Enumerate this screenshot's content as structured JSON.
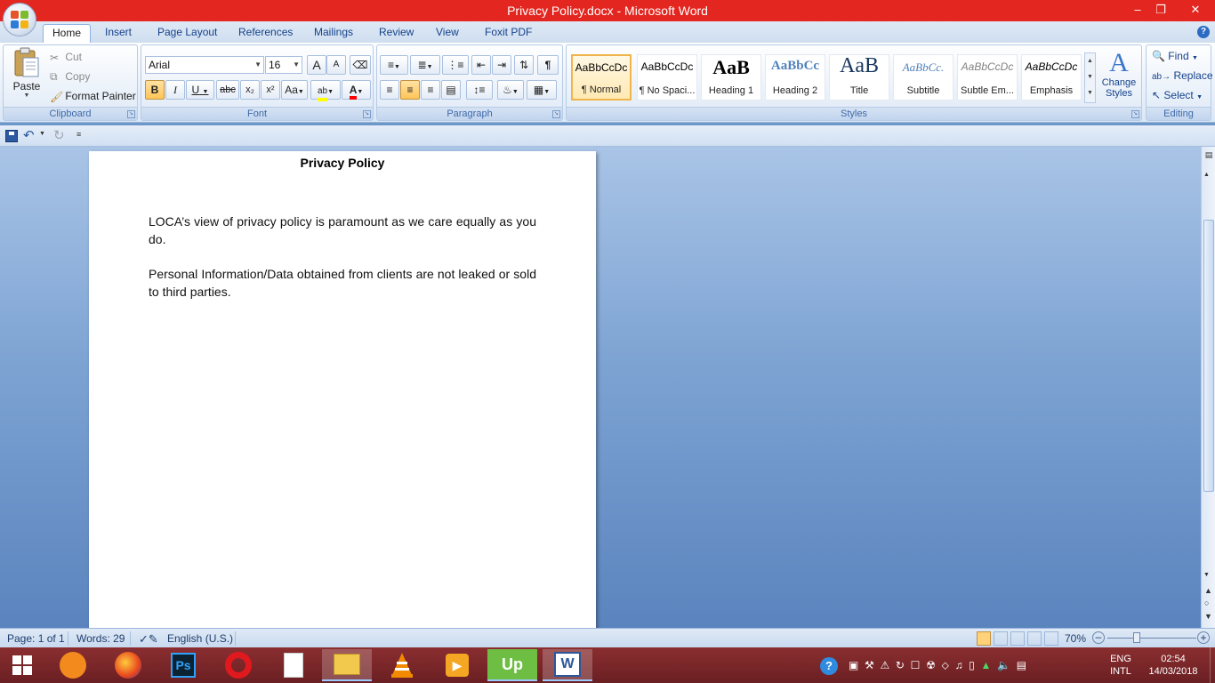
{
  "window": {
    "title": "Privacy Policy.docx - Microsoft Word"
  },
  "tabs": [
    "Home",
    "Insert",
    "Page Layout",
    "References",
    "Mailings",
    "Review",
    "View",
    "Foxit PDF"
  ],
  "clipboard": {
    "paste": "Paste",
    "cut": "Cut",
    "copy": "Copy",
    "format_painter": "Format Painter",
    "label": "Clipboard"
  },
  "font": {
    "name": "Arial",
    "size": "16",
    "label": "Font",
    "bold": "B",
    "italic": "I",
    "underline": "U",
    "strike": "abc",
    "sub": "x₂",
    "sup": "x²",
    "case": "Aa",
    "grow": "A",
    "shrink": "A"
  },
  "paragraph": {
    "label": "Paragraph"
  },
  "styles": {
    "label": "Styles",
    "items": [
      {
        "sample": "AaBbCcDc",
        "name": "¶ Normal"
      },
      {
        "sample": "AaBbCcDc",
        "name": "¶ No Spaci..."
      },
      {
        "sample": "AaB",
        "name": "Heading 1"
      },
      {
        "sample": "AaBbCc",
        "name": "Heading 2"
      },
      {
        "sample": "AaB",
        "name": "Title"
      },
      {
        "sample": "AaBbCc.",
        "name": "Subtitle"
      },
      {
        "sample": "AaBbCcDc",
        "name": "Subtle Em..."
      },
      {
        "sample": "AaBbCcDc",
        "name": "Emphasis"
      }
    ],
    "change_styles": "Change Styles"
  },
  "editing": {
    "find": "Find",
    "replace": "Replace",
    "select": "Select",
    "label": "Editing"
  },
  "document": {
    "title": "Privacy Policy",
    "paragraphs": [
      "LOCA’s view of privacy policy is paramount as we care equally as you do.",
      "Personal Information/Data obtained from clients are not leaked or sold to third parties."
    ]
  },
  "status": {
    "page": "Page: 1 of 1",
    "words": "Words: 29",
    "language": "English (U.S.)",
    "zoom": "70%"
  },
  "tray": {
    "lang1": "ENG",
    "lang2": "INTL",
    "time": "02:54",
    "date": "14/03/2018"
  },
  "colors": {
    "title_bar": "#e3261f",
    "taskbar": "#7a2628",
    "accent": "#15428b"
  }
}
